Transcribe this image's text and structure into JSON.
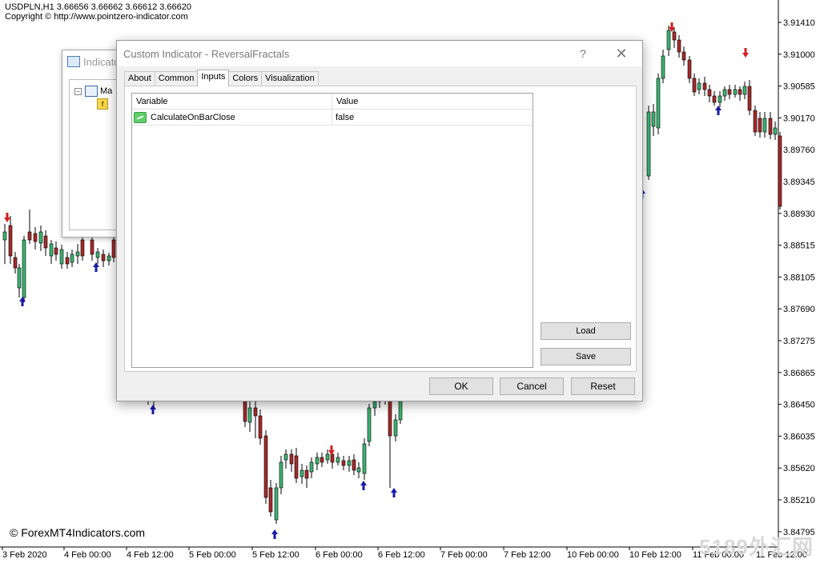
{
  "chart": {
    "header_line1": "USDPLN,H1  3.66656 3.66662 3.66612 3.66620",
    "header_line2": "Copyright © http://www.pointzero-indicator.com",
    "copyright": "© ForexMT4Indicators.com",
    "watermark": "5189外汇网",
    "price_labels": [
      "3.91410",
      "3.91000",
      "3.90585",
      "3.90170",
      "3.89760",
      "3.89345",
      "3.88930",
      "3.88515",
      "3.88105",
      "3.87690",
      "3.87275",
      "3.86865",
      "3.86450",
      "3.86035",
      "3.85620",
      "3.85210",
      "3.84795"
    ],
    "time_labels": [
      "3 Feb 2020",
      "4 Feb 00:00",
      "4 Feb 12:00",
      "5 Feb 00:00",
      "5 Feb 12:00",
      "6 Feb 00:00",
      "6 Feb 12:00",
      "7 Feb 00:00",
      "7 Feb 12:00",
      "10 Feb 00:00",
      "10 Feb 12:00",
      "11 Feb 00:00",
      "11 Feb 12:00"
    ],
    "colors": {
      "bull": "#3cb371",
      "bear": "#a52a2a",
      "up_arrow": "#1a1aa8",
      "down_arrow": "#d42020"
    }
  },
  "navigator": {
    "title": "Indicato",
    "item_label": "Ma"
  },
  "dialog": {
    "title": "Custom Indicator - ReversalFractals",
    "help": "?",
    "close": "✕",
    "tabs": [
      "About",
      "Common",
      "Inputs",
      "Colors",
      "Visualization"
    ],
    "active_tab": "Inputs",
    "grid": {
      "col_variable": "Variable",
      "col_value": "Value",
      "rows": [
        {
          "variable": "CalculateOnBarClose",
          "value": "false"
        }
      ]
    },
    "buttons": {
      "load": "Load",
      "save": "Save",
      "ok": "OK",
      "cancel": "Cancel",
      "reset": "Reset"
    }
  }
}
